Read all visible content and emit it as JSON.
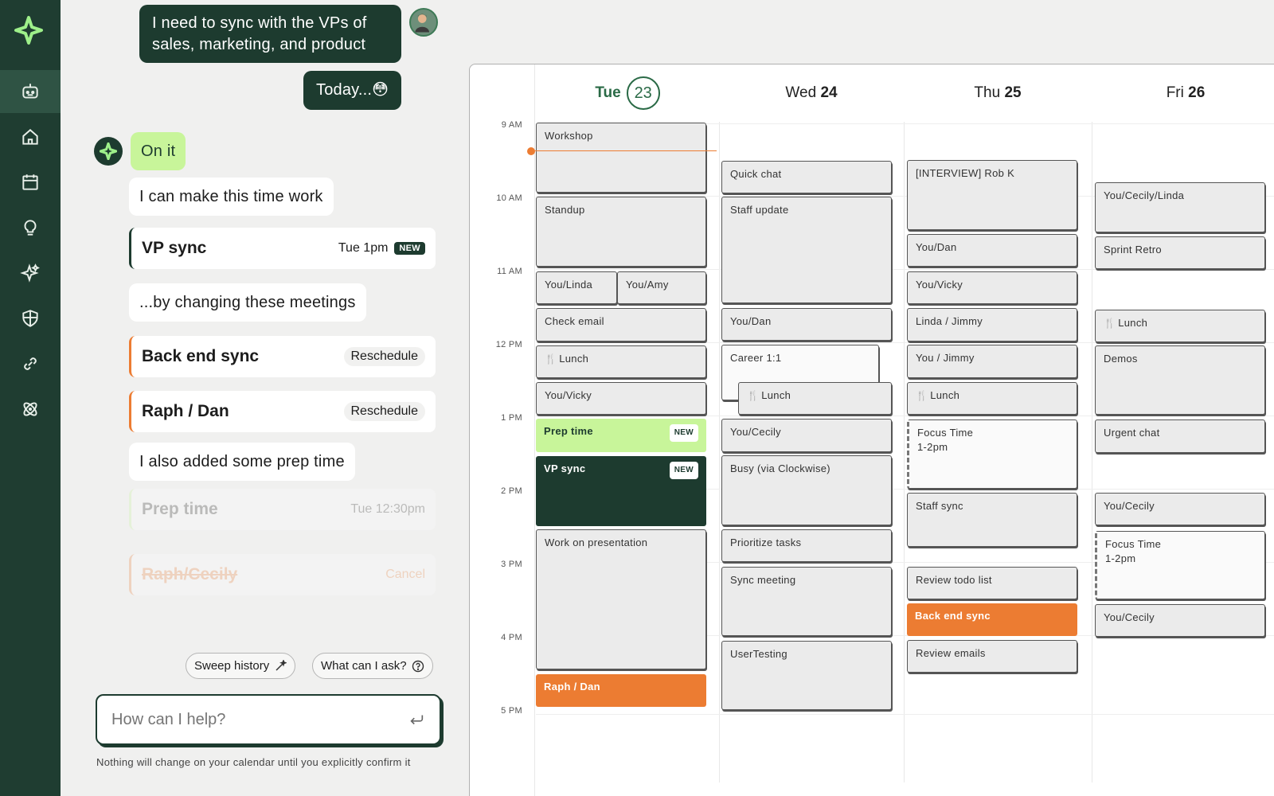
{
  "sidebar": {
    "logo_icon": "sparkle-logo-icon",
    "items": [
      {
        "name": "assistant",
        "icon": "robot-icon",
        "active": true
      },
      {
        "name": "home",
        "icon": "home-icon"
      },
      {
        "name": "calendar",
        "icon": "calendar-icon"
      },
      {
        "name": "ideas",
        "icon": "lightbulb-icon"
      },
      {
        "name": "sparkles",
        "icon": "sparkles-icon"
      },
      {
        "name": "shield",
        "icon": "shield-icon"
      },
      {
        "name": "links",
        "icon": "link-icon"
      },
      {
        "name": "integrations",
        "icon": "atom-icon"
      }
    ]
  },
  "chat": {
    "user_message_1": [
      "I need to sync with the VPs of",
      "sales, marketing, and product"
    ],
    "user_message_2": "Today...😳",
    "bot_reply": "On it",
    "bot_msg_1": "I can make this time work",
    "vp_card": {
      "title": "VP sync",
      "time": "Tue 1pm",
      "badge": "NEW"
    },
    "bot_msg_2": "...by changing these meetings",
    "reschedule_cards": [
      {
        "title": "Back end sync",
        "action": "Reschedule"
      },
      {
        "title": "Raph / Dan",
        "action": "Reschedule"
      }
    ],
    "bot_msg_3": "I also added some prep time",
    "prep_card": {
      "title": "Prep time",
      "time": "Tue 12:30pm"
    },
    "cancel_card": {
      "title": "Raph/Cecily",
      "action": "Cancel"
    },
    "chips": {
      "history": "Sweep history",
      "ask": "What can I ask?"
    },
    "input_placeholder": "How can I help?",
    "disclaimer": "Nothing will change on your calendar until you explicitly confirm it"
  },
  "calendar": {
    "days": [
      {
        "dow": "Tue",
        "date": "23",
        "today": true
      },
      {
        "dow": "Wed",
        "date": "24"
      },
      {
        "dow": "Thu",
        "date": "25"
      },
      {
        "dow": "Fri",
        "date": "26"
      }
    ],
    "hours": [
      "9 AM",
      "10 AM",
      "11 AM",
      "12 PM",
      "1 PM",
      "2 PM",
      "3 PM",
      "4 PM",
      "5 PM"
    ],
    "events": {
      "tue": {
        "workshop": "Workshop",
        "standup": "Standup",
        "you_linda": "You/Linda",
        "you_amy": "You/Amy",
        "check_email": "Check email",
        "lunch": "Lunch",
        "you_vicky": "You/Vicky",
        "prep_time": "Prep time",
        "prep_badge": "NEW",
        "vp_sync": "VP sync",
        "vp_badge": "NEW",
        "presentation": "Work on presentation",
        "raph_dan": "Raph / Dan"
      },
      "wed": {
        "quick_chat": "Quick chat",
        "staff_update": "Staff update",
        "you_dan": "You/Dan",
        "career": "Career 1:1",
        "lunch": "Lunch",
        "you_cecily": "You/Cecily",
        "busy": "Busy (via Clockwise)",
        "prioritize": "Prioritize tasks",
        "sync_meeting": "Sync meeting",
        "user_testing": "UserTesting"
      },
      "thu": {
        "interview": "[INTERVIEW] Rob K",
        "you_dan": "You/Dan",
        "you_vicky": "You/Vicky",
        "linda_jimmy": "Linda / Jimmy",
        "you_jimmy": "You / Jimmy",
        "lunch": "Lunch",
        "focus": "Focus Time",
        "focus_time": "1-2pm",
        "staff_sync": "Staff sync",
        "review_todo": "Review todo list",
        "back_end_sync": "Back end sync",
        "review_emails": "Review emails"
      },
      "fri": {
        "you_cecily_linda": "You/Cecily/Linda",
        "sprint_retro": "Sprint Retro",
        "lunch": "Lunch",
        "demos": "Demos",
        "urgent_chat": "Urgent chat",
        "you_cecily_1": "You/Cecily",
        "focus": "Focus Time",
        "focus_time": "1-2pm",
        "you_cecily_2": "You/Cecily"
      }
    }
  },
  "colors": {
    "sidebar": "#1f3d31",
    "dark_green": "#1d3b2f",
    "lime": "#c8f59a",
    "orange": "#ec7c32",
    "today": "#2a6a46"
  }
}
